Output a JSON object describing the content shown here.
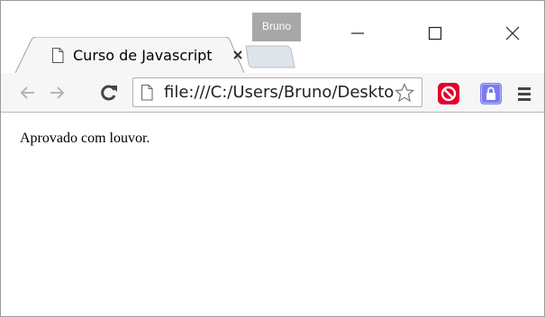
{
  "window": {
    "profile_name": "Bruno"
  },
  "tabs": [
    {
      "title": "Curso de Javascript",
      "active": true
    }
  ],
  "toolbar": {
    "url": "file:///C:/Users/Bruno/Desktop",
    "icons": [
      "back-icon",
      "forward-icon",
      "reload-icon",
      "page-icon",
      "star-icon",
      "extension-icon",
      "extension-icon",
      "menu-icon"
    ]
  },
  "content": {
    "text": "Aprovado com louvor."
  },
  "colors": {
    "profile_badge": "#a8a8a8",
    "toolbar_bg": "#f6f6f6",
    "ext_red": "#e4002b",
    "ext_purple": "#7b7bf0"
  }
}
